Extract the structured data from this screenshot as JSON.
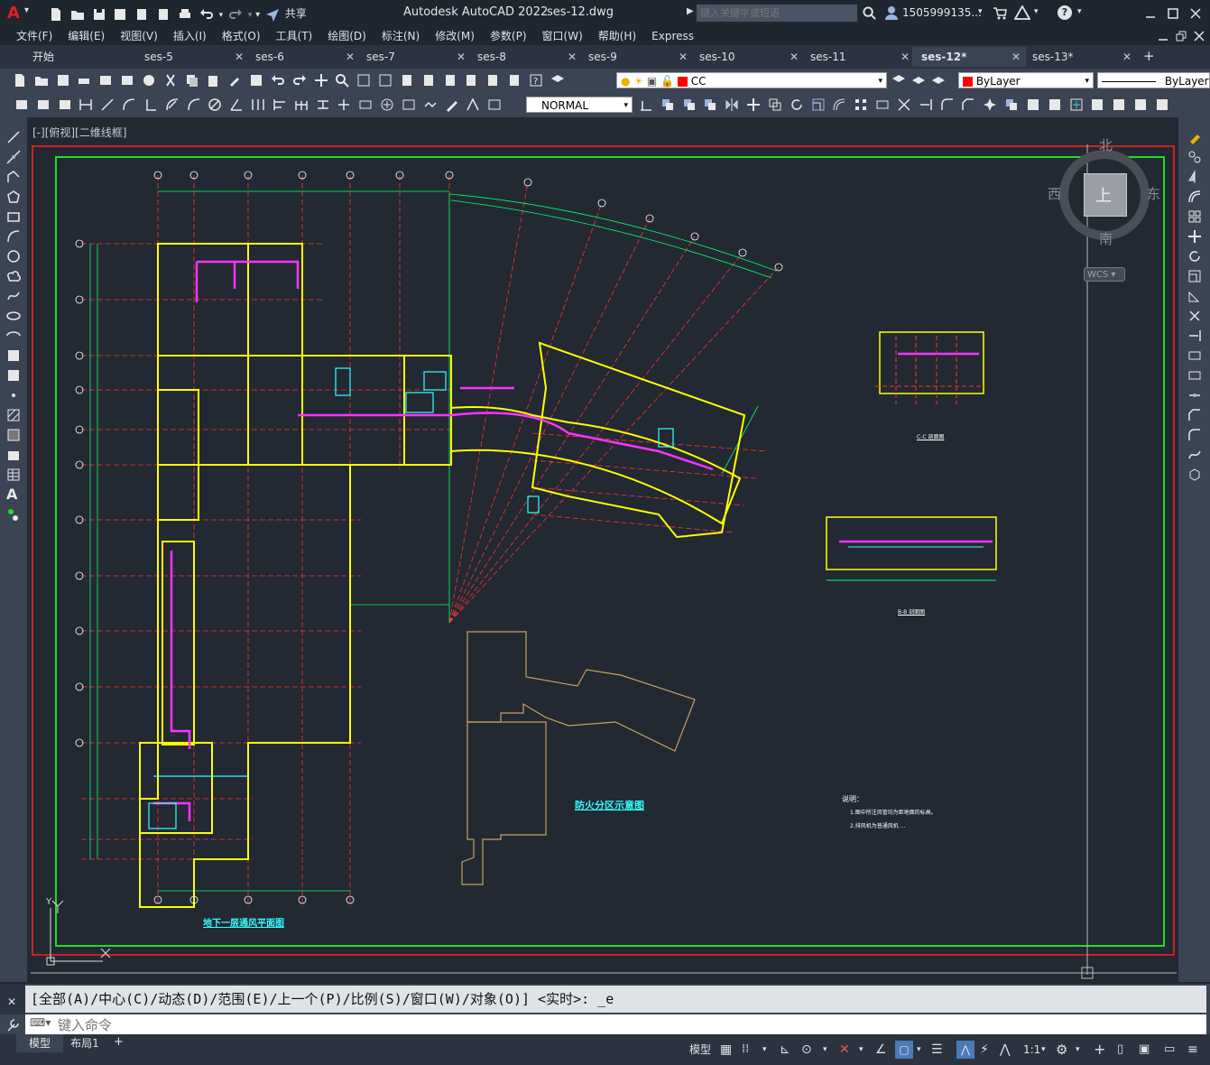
{
  "app": {
    "logo": "A",
    "title": "Autodesk AutoCAD 2022",
    "filename": "ses-12.dwg",
    "share_label": "共享",
    "search_placeholder": "键入关键字或短语",
    "user": "1505999135...",
    "help_icon": "?"
  },
  "menu": [
    "文件(F)",
    "编辑(E)",
    "视图(V)",
    "插入(I)",
    "格式(O)",
    "工具(T)",
    "绘图(D)",
    "标注(N)",
    "修改(M)",
    "参数(P)",
    "窗口(W)",
    "帮助(H)",
    "Express"
  ],
  "tabs": [
    {
      "label": "开始",
      "active": false,
      "closable": false
    },
    {
      "label": "ses-5",
      "active": false,
      "closable": true
    },
    {
      "label": "ses-6",
      "active": false,
      "closable": true
    },
    {
      "label": "ses-7",
      "active": false,
      "closable": true
    },
    {
      "label": "ses-8",
      "active": false,
      "closable": true
    },
    {
      "label": "ses-9",
      "active": false,
      "closable": true
    },
    {
      "label": "ses-10",
      "active": false,
      "closable": true
    },
    {
      "label": "ses-11",
      "active": false,
      "closable": true
    },
    {
      "label": "ses-12*",
      "active": true,
      "closable": true
    },
    {
      "label": "ses-13*",
      "active": false,
      "closable": true
    }
  ],
  "add_tab": "+",
  "properties": {
    "layer": "CC",
    "color": "ByLayer",
    "linetype": "ByLayer",
    "text_style": "NORMAL"
  },
  "viewport": {
    "label": "[-][俯视][二维线框]",
    "viewcube": {
      "north": "北",
      "south": "南",
      "east": "东",
      "west": "西",
      "top": "上",
      "wcs": "WCS"
    },
    "ucs_x": "X",
    "ucs_y": "Y"
  },
  "drawing": {
    "main_title": "地下一层通风平面图",
    "fire_zone_title": "防火分区示意图",
    "notes_title": "说明：",
    "notes": [
      "1.图中所注风管均为距地面的标高。",
      "2.排风机为普通风机 ..."
    ],
    "section1": "C-C 剖面图",
    "section2": "B-B 剖面图",
    "grid_cols": [
      "1",
      "2",
      "3",
      "4",
      "5",
      "6",
      "7"
    ],
    "grid_rows": [
      "L",
      "K",
      "J",
      "H",
      "G",
      "F",
      "E",
      "D",
      "C",
      "B",
      "A"
    ],
    "colors": {
      "frame_red": "#ff2020",
      "frame_green": "#22dd22",
      "wall_yellow": "#ffff00",
      "duct_magenta": "#ff33ff",
      "dim_green": "#00ff66",
      "grid_red": "#ff3333",
      "cyan": "#33ffff",
      "zone_tan": "#c8a060"
    }
  },
  "command": {
    "history": "[全部(A)/中心(C)/动态(D)/范围(E)/上一个(P)/比例(S)/窗口(W)/对象(O)] <实时>: _e",
    "placeholder": "键入命令"
  },
  "status": {
    "layout_tabs": [
      "模型",
      "布局1"
    ],
    "model_label": "模型",
    "scale": "1:1"
  }
}
